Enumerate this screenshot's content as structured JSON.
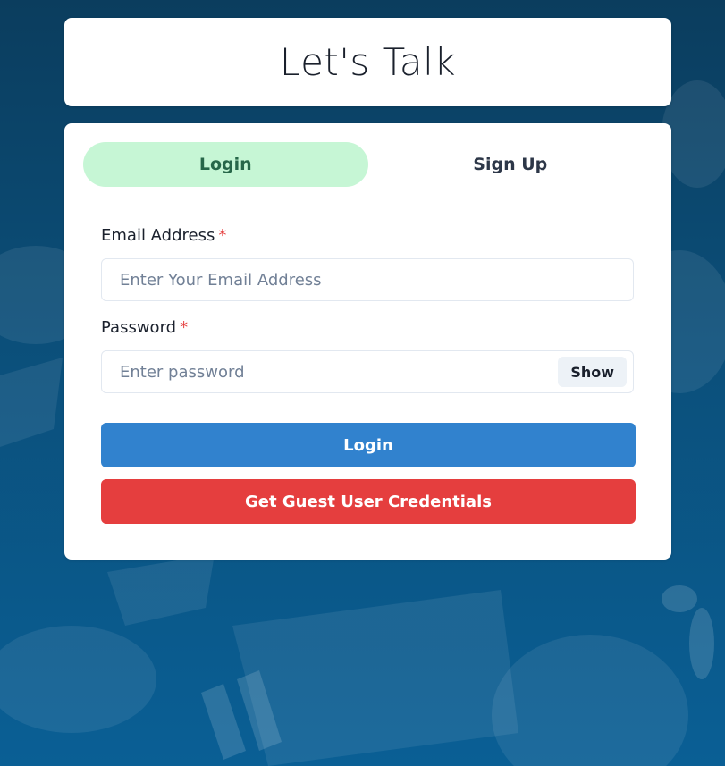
{
  "header": {
    "title": "Let's Talk"
  },
  "tabs": [
    {
      "label": "Login",
      "active": true
    },
    {
      "label": "Sign Up",
      "active": false
    }
  ],
  "form": {
    "email": {
      "label": "Email Address",
      "required_marker": "*",
      "placeholder": "Enter Your Email Address",
      "value": ""
    },
    "password": {
      "label": "Password",
      "required_marker": "*",
      "placeholder": "Enter password",
      "value": "",
      "toggle_label": "Show"
    },
    "submit_label": "Login",
    "guest_label": "Get Guest User Credentials"
  },
  "colors": {
    "active_tab_bg": "#c6f6d5",
    "login_button": "#3182ce",
    "guest_button": "#e53e3e",
    "required_marker": "#e53e3e",
    "background": "#0b4f7a"
  }
}
